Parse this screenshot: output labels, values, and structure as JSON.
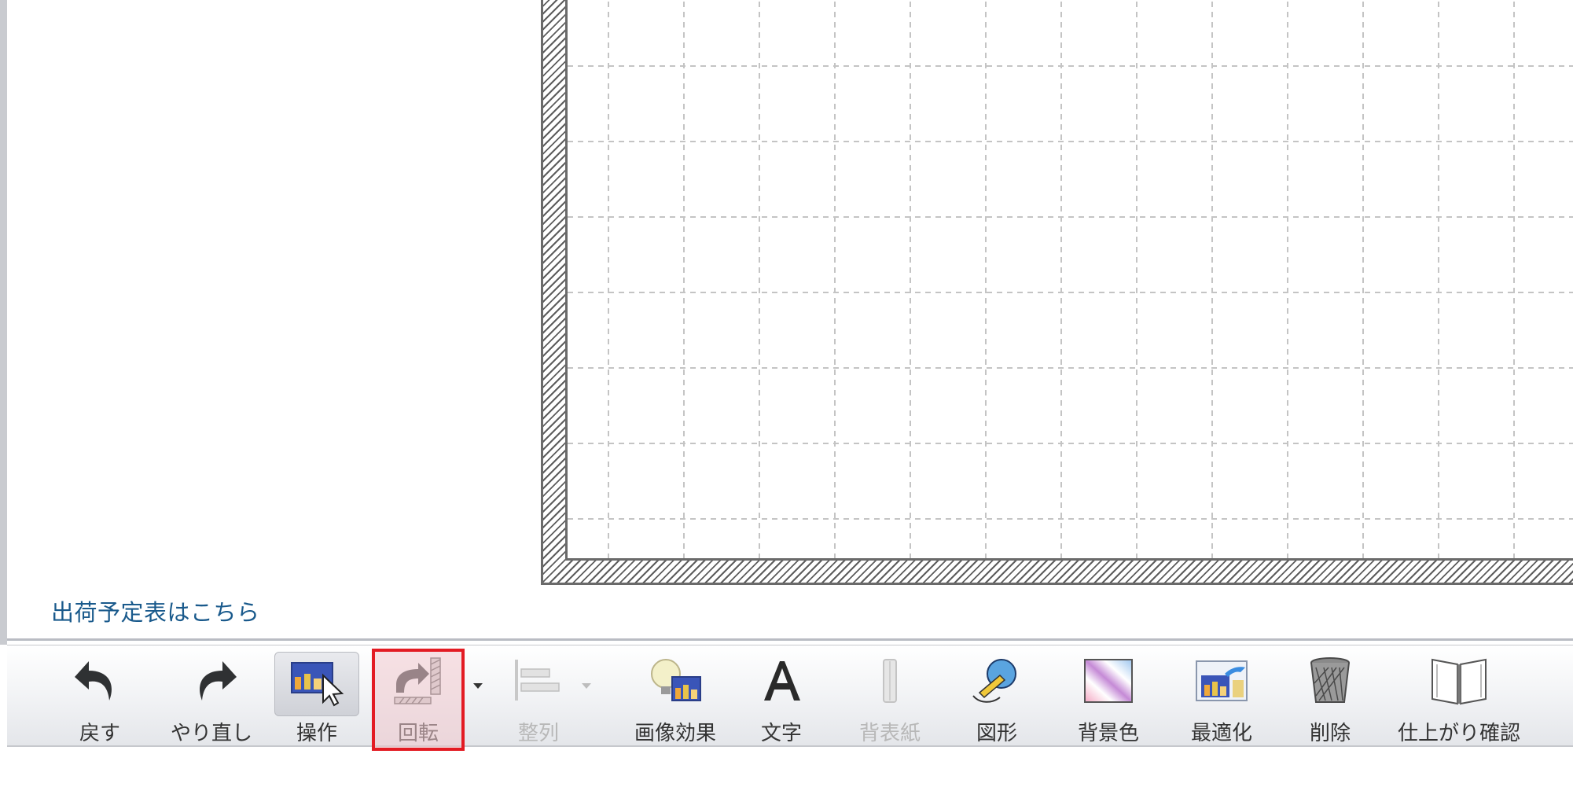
{
  "links": {
    "shipping_schedule": "出荷予定表はこちら"
  },
  "toolbar": {
    "items": [
      {
        "label": "戻す",
        "icon": "undo-icon",
        "state": "enabled"
      },
      {
        "label": "やり直し",
        "icon": "redo-icon",
        "state": "enabled"
      },
      {
        "label": "操作",
        "icon": "operate-cursor-icon",
        "state": "active"
      },
      {
        "label": "回転",
        "icon": "rotate-icon",
        "state": "highlighted",
        "has_dropdown": true
      },
      {
        "label": "整列",
        "icon": "align-icon",
        "state": "disabled",
        "has_dropdown": true
      },
      {
        "label": "画像効果",
        "icon": "image-effect-icon",
        "state": "enabled"
      },
      {
        "label": "文字",
        "icon": "text-icon",
        "state": "enabled"
      },
      {
        "label": "背表紙",
        "icon": "spine-icon",
        "state": "disabled"
      },
      {
        "label": "図形",
        "icon": "shape-icon",
        "state": "enabled"
      },
      {
        "label": "背景色",
        "icon": "background-color-icon",
        "state": "enabled"
      },
      {
        "label": "最適化",
        "icon": "optimize-icon",
        "state": "enabled"
      },
      {
        "label": "削除",
        "icon": "trash-icon",
        "state": "enabled"
      },
      {
        "label": "仕上がり確認",
        "icon": "preview-book-icon",
        "state": "enabled"
      }
    ]
  },
  "colors": {
    "highlight_border": "#e31b23",
    "link": "#1a5a8c",
    "label": "#333333",
    "disabled_label": "#b8b8b8"
  }
}
